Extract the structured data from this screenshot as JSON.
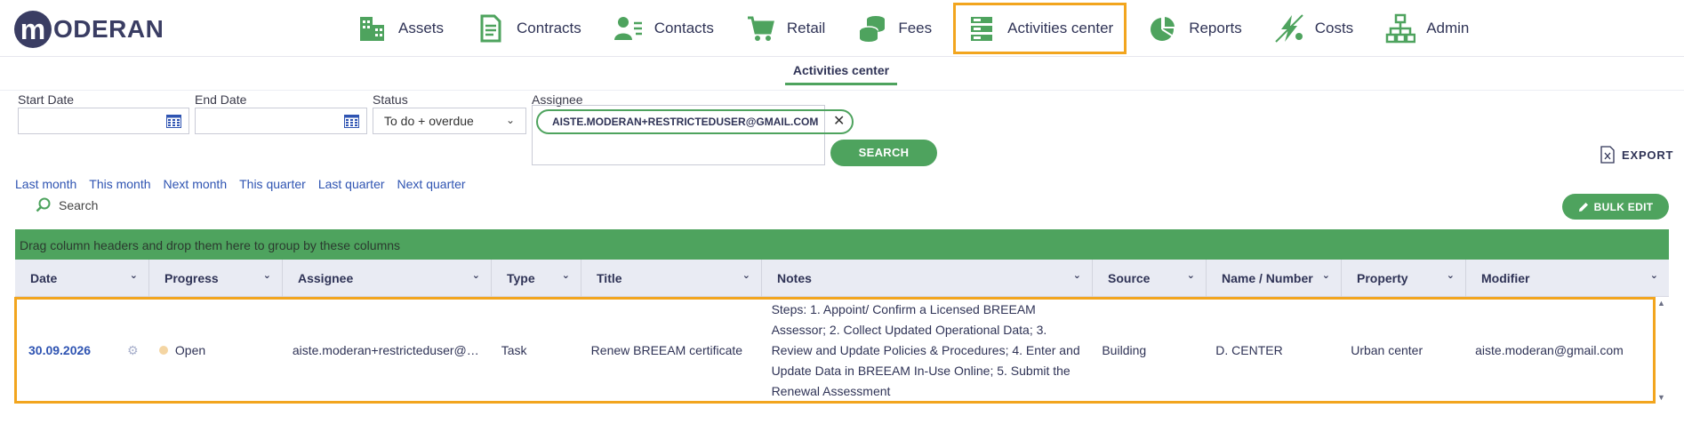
{
  "logo": {
    "letter": "m",
    "text": "ODERAN"
  },
  "nav": [
    {
      "label": "Assets",
      "icon": "buildings-icon"
    },
    {
      "label": "Contracts",
      "icon": "document-icon"
    },
    {
      "label": "Contacts",
      "icon": "person-list-icon"
    },
    {
      "label": "Retail",
      "icon": "cart-icon"
    },
    {
      "label": "Fees",
      "icon": "coins-icon"
    },
    {
      "label": "Activities center",
      "icon": "tasks-icon",
      "active": true
    },
    {
      "label": "Reports",
      "icon": "pie-chart-icon"
    },
    {
      "label": "Costs",
      "icon": "energy-icon"
    },
    {
      "label": "Admin",
      "icon": "org-chart-icon"
    }
  ],
  "subtab": "Activities center",
  "filters": {
    "start_date_label": "Start Date",
    "end_date_label": "End Date",
    "status_label": "Status",
    "status_value": "To do + overdue",
    "assignee_label": "Assignee",
    "assignee_chip": "AISTE.MODERAN+RESTRICTEDUSER@GMAIL.COM",
    "search_button": "SEARCH",
    "export_label": "EXPORT"
  },
  "quick_links": [
    "Last month",
    "This month",
    "Next month",
    "This quarter",
    "Last quarter",
    "Next quarter"
  ],
  "search_label": "Search",
  "bulk_edit": "BULK EDIT",
  "group_bar": "Drag column headers and drop them here to group by these columns",
  "columns": [
    "Date",
    "Progress",
    "Assignee",
    "Type",
    "Title",
    "Notes",
    "Source",
    "Name / Number",
    "Property",
    "Modifier"
  ],
  "row": {
    "date": "30.09.2026",
    "progress": "Open",
    "assignee": "aiste.moderan+restricteduser@gmail.com",
    "type": "Task",
    "title": "Renew BREEAM certificate",
    "notes": "Steps: 1. Appoint/ Confirm a Licensed BREEAM Assessor; 2. Collect Updated Operational Data; 3. Review and Update Policies & Procedures; 4. Enter and Update Data in BREEAM In-Use Online; 5. Submit the Renewal Assessment",
    "source": "Building",
    "name_number": "D. CENTER",
    "property": "Urban center",
    "modifier": "aiste.moderan@gmail.com"
  },
  "colors": {
    "accent_green": "#4ea35e",
    "highlight_orange": "#f2a51e",
    "navy": "#3a3d63",
    "link_blue": "#2f54b2"
  }
}
